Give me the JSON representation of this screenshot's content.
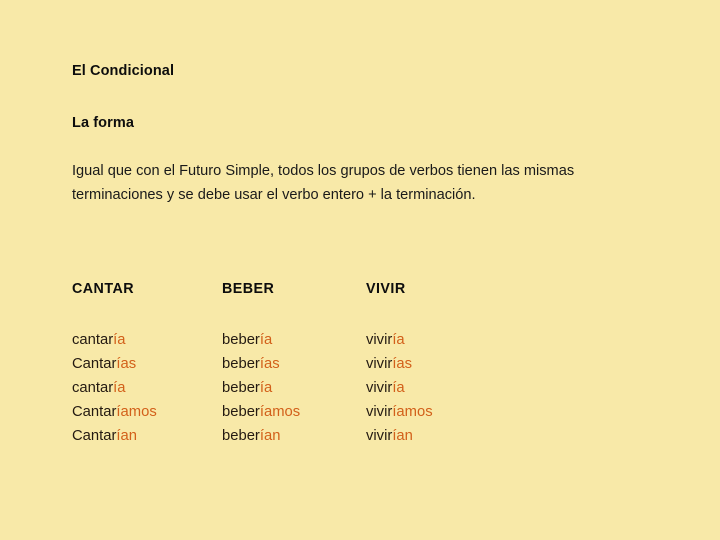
{
  "slide": {
    "background_color": "#f8e9a8",
    "title": "El Condicional",
    "subtitle": "La forma",
    "body_paragraph": "Igual que con el Futuro Simple, todos los grupos de verbos tienen las mismas terminaciones y se debe usar el verbo entero + la terminación."
  },
  "colors": {
    "background": "#f8e9a8",
    "heading_text": "#0d0d0d",
    "body_text": "#1a1a1a",
    "verb_stem": "#241a11",
    "verb_ending": "#d2601a"
  },
  "table": {
    "columns": [
      {
        "header": "CANTAR",
        "rows": [
          {
            "stem": "cantar",
            "ending": "ía"
          },
          {
            "stem": "Cantar",
            "ending": "ías"
          },
          {
            "stem": "cantar",
            "ending": "ía"
          },
          {
            "stem": "Cantar",
            "ending": "íamos"
          },
          {
            "stem": "Cantar",
            "ending": "ían"
          }
        ]
      },
      {
        "header": "BEBER",
        "rows": [
          {
            "stem": "beber",
            "ending": "ía"
          },
          {
            "stem": "beber",
            "ending": "ías"
          },
          {
            "stem": "beber",
            "ending": "ía"
          },
          {
            "stem": "beber",
            "ending": "íamos"
          },
          {
            "stem": "beber",
            "ending": "ían"
          }
        ]
      },
      {
        "header": "VIVIR",
        "rows": [
          {
            "stem": "vivir",
            "ending": "ía"
          },
          {
            "stem": "vivir",
            "ending": "ías"
          },
          {
            "stem": "vivir",
            "ending": "ía"
          },
          {
            "stem": "vivir",
            "ending": "íamos"
          },
          {
            "stem": "vivir",
            "ending": "ían"
          }
        ]
      }
    ]
  }
}
